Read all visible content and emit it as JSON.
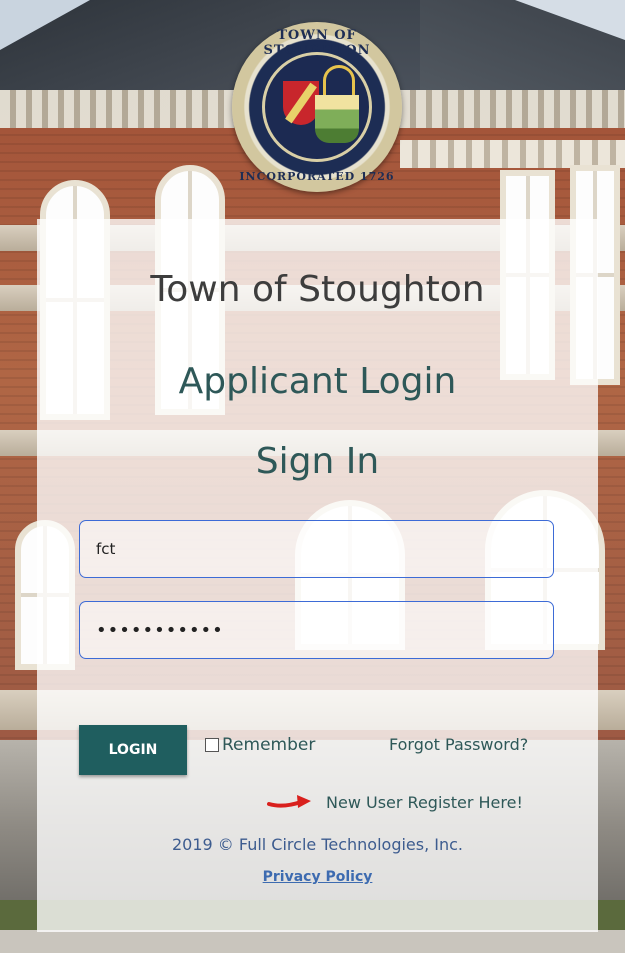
{
  "seal": {
    "text_top": "TOWN OF STOUGHTON",
    "text_bottom": "INCORPORATED 1726"
  },
  "header": {
    "town_name": "Town of Stoughton",
    "page_title": "Applicant Login",
    "section_title": "Sign In"
  },
  "form": {
    "username_value": "fct",
    "password_value": "•••••••••••"
  },
  "actions": {
    "login_label": "LOGIN",
    "remember_label": "Remember",
    "forgot_label": "Forgot Password?",
    "register_label": "New User Register Here!"
  },
  "footer": {
    "copyright": "2019 © Full Circle Technologies, Inc.",
    "privacy_label": "Privacy Policy"
  },
  "colors": {
    "accent": "#1f5e5f",
    "title_teal": "#2e5858",
    "link_blue": "#3d6bb0",
    "arrow_red": "#d9201d"
  }
}
